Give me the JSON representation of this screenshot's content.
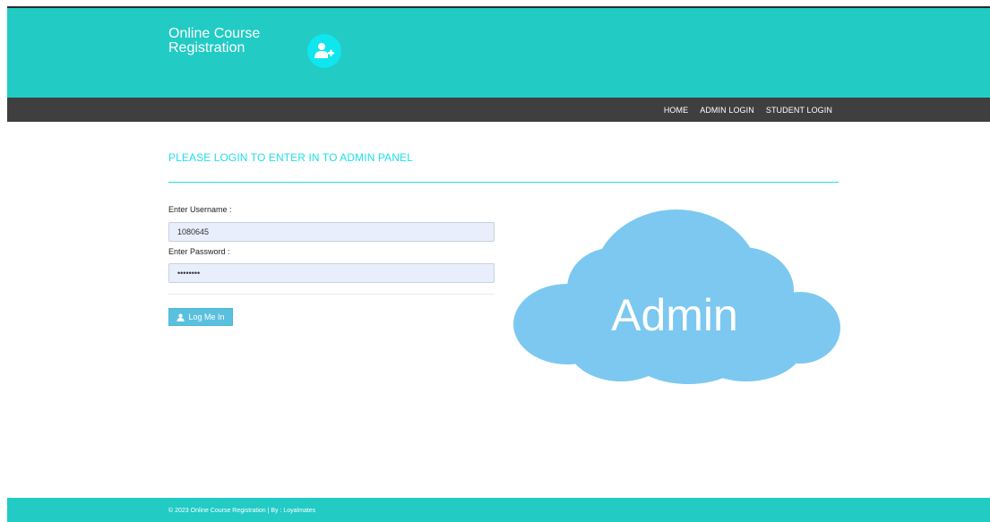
{
  "header": {
    "brand_line1": "Online Course",
    "brand_line2": "Registration",
    "logo_icon": "user-plus-icon"
  },
  "nav": {
    "items": [
      {
        "label": "HOME"
      },
      {
        "label": "ADMIN LOGIN"
      },
      {
        "label": "STUDENT LOGIN"
      }
    ]
  },
  "main": {
    "panel_title": "PLEASE LOGIN TO ENTER IN TO ADMIN PANEL",
    "username_label": "Enter Username :",
    "username_value": "1080645",
    "password_label": "Enter Password :",
    "password_value": "••••••••",
    "login_button": "Log Me In",
    "login_icon": "user-icon",
    "cloud_text": "Admin"
  },
  "footer": {
    "text": "© 2023 Online Course Registration | By : Loyalmates"
  },
  "colors": {
    "header_bg": "#22cbc4",
    "nav_bg": "#3f3f3f",
    "accent": "#1fdfe7",
    "button_bg": "#5bc0de",
    "cloud": "#7cc8f0",
    "input_bg": "#e8eefc"
  }
}
